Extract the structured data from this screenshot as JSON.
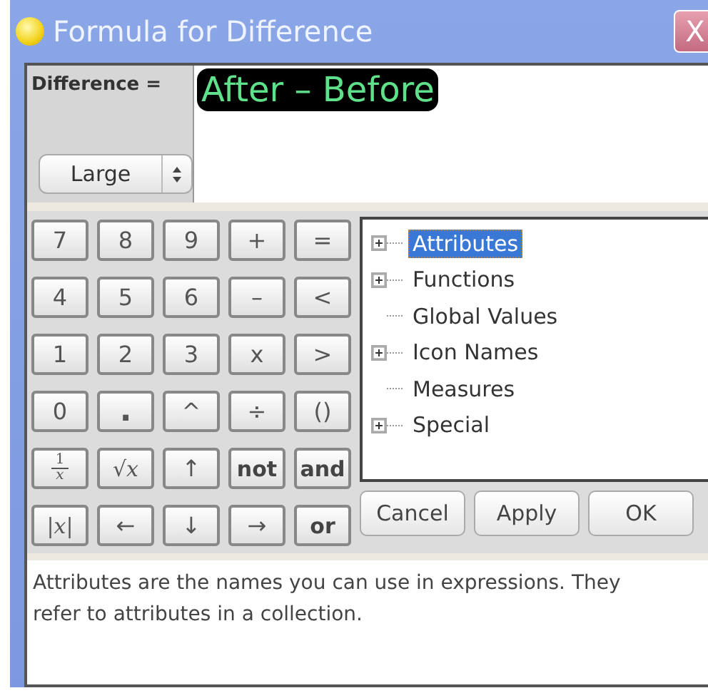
{
  "window": {
    "title": "Formula for Difference",
    "close_label": "X"
  },
  "formula": {
    "label": "Difference =",
    "expression": "After – Before",
    "size_menu": {
      "value": "Large"
    }
  },
  "keypad": [
    {
      "kind": "text",
      "label": "7"
    },
    {
      "kind": "text",
      "label": "8"
    },
    {
      "kind": "text",
      "label": "9"
    },
    {
      "kind": "text",
      "label": "+"
    },
    {
      "kind": "text",
      "label": "="
    },
    {
      "kind": "text",
      "label": "4"
    },
    {
      "kind": "text",
      "label": "5"
    },
    {
      "kind": "text",
      "label": "6"
    },
    {
      "kind": "text",
      "label": "–"
    },
    {
      "kind": "text",
      "label": "<"
    },
    {
      "kind": "text",
      "label": "1"
    },
    {
      "kind": "text",
      "label": "2"
    },
    {
      "kind": "text",
      "label": "3"
    },
    {
      "kind": "text",
      "label": "x"
    },
    {
      "kind": "text",
      "label": ">"
    },
    {
      "kind": "text",
      "label": "0"
    },
    {
      "kind": "dot",
      "label": "."
    },
    {
      "kind": "text",
      "label": "^"
    },
    {
      "kind": "text",
      "label": "÷"
    },
    {
      "kind": "text",
      "label": "()"
    },
    {
      "kind": "fraction",
      "numerator": "1",
      "denominator": "x"
    },
    {
      "kind": "math",
      "label": "√x"
    },
    {
      "kind": "text",
      "label": "↑"
    },
    {
      "kind": "word",
      "label": "not"
    },
    {
      "kind": "word",
      "label": "and"
    },
    {
      "kind": "math",
      "label": "|x|"
    },
    {
      "kind": "text",
      "label": "←"
    },
    {
      "kind": "text",
      "label": "↓"
    },
    {
      "kind": "text",
      "label": "→"
    },
    {
      "kind": "word",
      "label": "or"
    }
  ],
  "tree": [
    {
      "label": "Attributes",
      "expandable": true,
      "selected": true
    },
    {
      "label": "Functions",
      "expandable": true,
      "selected": false
    },
    {
      "label": "Global Values",
      "expandable": false,
      "selected": false
    },
    {
      "label": "Icon Names",
      "expandable": true,
      "selected": false
    },
    {
      "label": "Measures",
      "expandable": false,
      "selected": false
    },
    {
      "label": "Special",
      "expandable": true,
      "selected": false
    }
  ],
  "buttons": [
    "Cancel",
    "Apply",
    "OK"
  ],
  "description": "Attributes are the names you can use in expressions. They refer to attributes in a collection."
}
